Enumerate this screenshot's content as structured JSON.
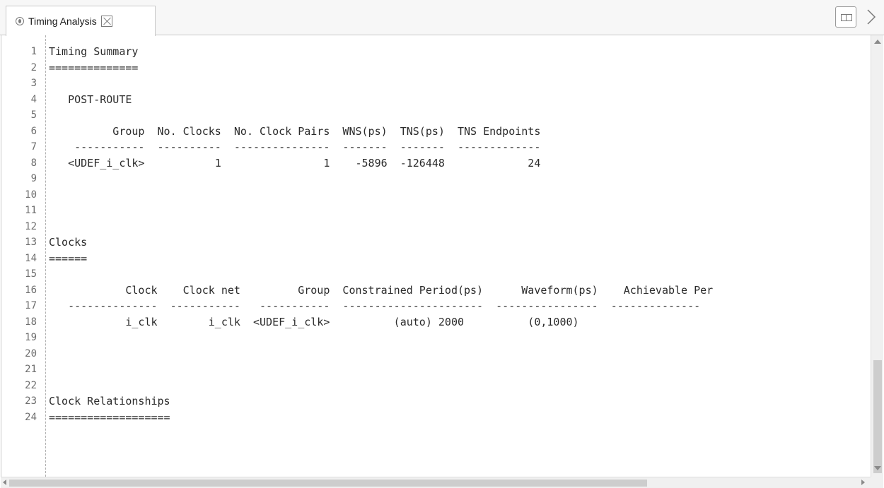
{
  "tab": {
    "title": "Timing Analysis",
    "icon": "info-icon"
  },
  "toolbar": {
    "split_icon": "split-view-icon",
    "more_icon": "chevron-right-icon"
  },
  "editor": {
    "lines": [
      {
        "num": "1",
        "text": "Timing Summary"
      },
      {
        "num": "2",
        "text": "=============="
      },
      {
        "num": "3",
        "text": ""
      },
      {
        "num": "4",
        "text": "   POST-ROUTE"
      },
      {
        "num": "5",
        "text": ""
      },
      {
        "num": "6",
        "text": "          Group  No. Clocks  No. Clock Pairs  WNS(ps)  TNS(ps)  TNS Endpoints"
      },
      {
        "num": "7",
        "text": "    -----------  ----------  ---------------  -------  -------  -------------"
      },
      {
        "num": "8",
        "text": "   <UDEF_i_clk>           1                1    -5896  -126448             24"
      },
      {
        "num": "9",
        "text": ""
      },
      {
        "num": "10",
        "text": ""
      },
      {
        "num": "11",
        "text": ""
      },
      {
        "num": "12",
        "text": ""
      },
      {
        "num": "13",
        "text": "Clocks"
      },
      {
        "num": "14",
        "text": "======"
      },
      {
        "num": "15",
        "text": ""
      },
      {
        "num": "16",
        "text": "            Clock    Clock net         Group  Constrained Period(ps)      Waveform(ps)    Achievable Per"
      },
      {
        "num": "17",
        "text": "   --------------  -----------   -----------  ----------------------  ----------------  --------------"
      },
      {
        "num": "18",
        "text": "            i_clk        i_clk  <UDEF_i_clk>          (auto) 2000          (0,1000)"
      },
      {
        "num": "19",
        "text": ""
      },
      {
        "num": "20",
        "text": ""
      },
      {
        "num": "21",
        "text": ""
      },
      {
        "num": "22",
        "text": ""
      },
      {
        "num": "23",
        "text": "Clock Relationships"
      },
      {
        "num": "24",
        "text": "==================="
      }
    ]
  }
}
